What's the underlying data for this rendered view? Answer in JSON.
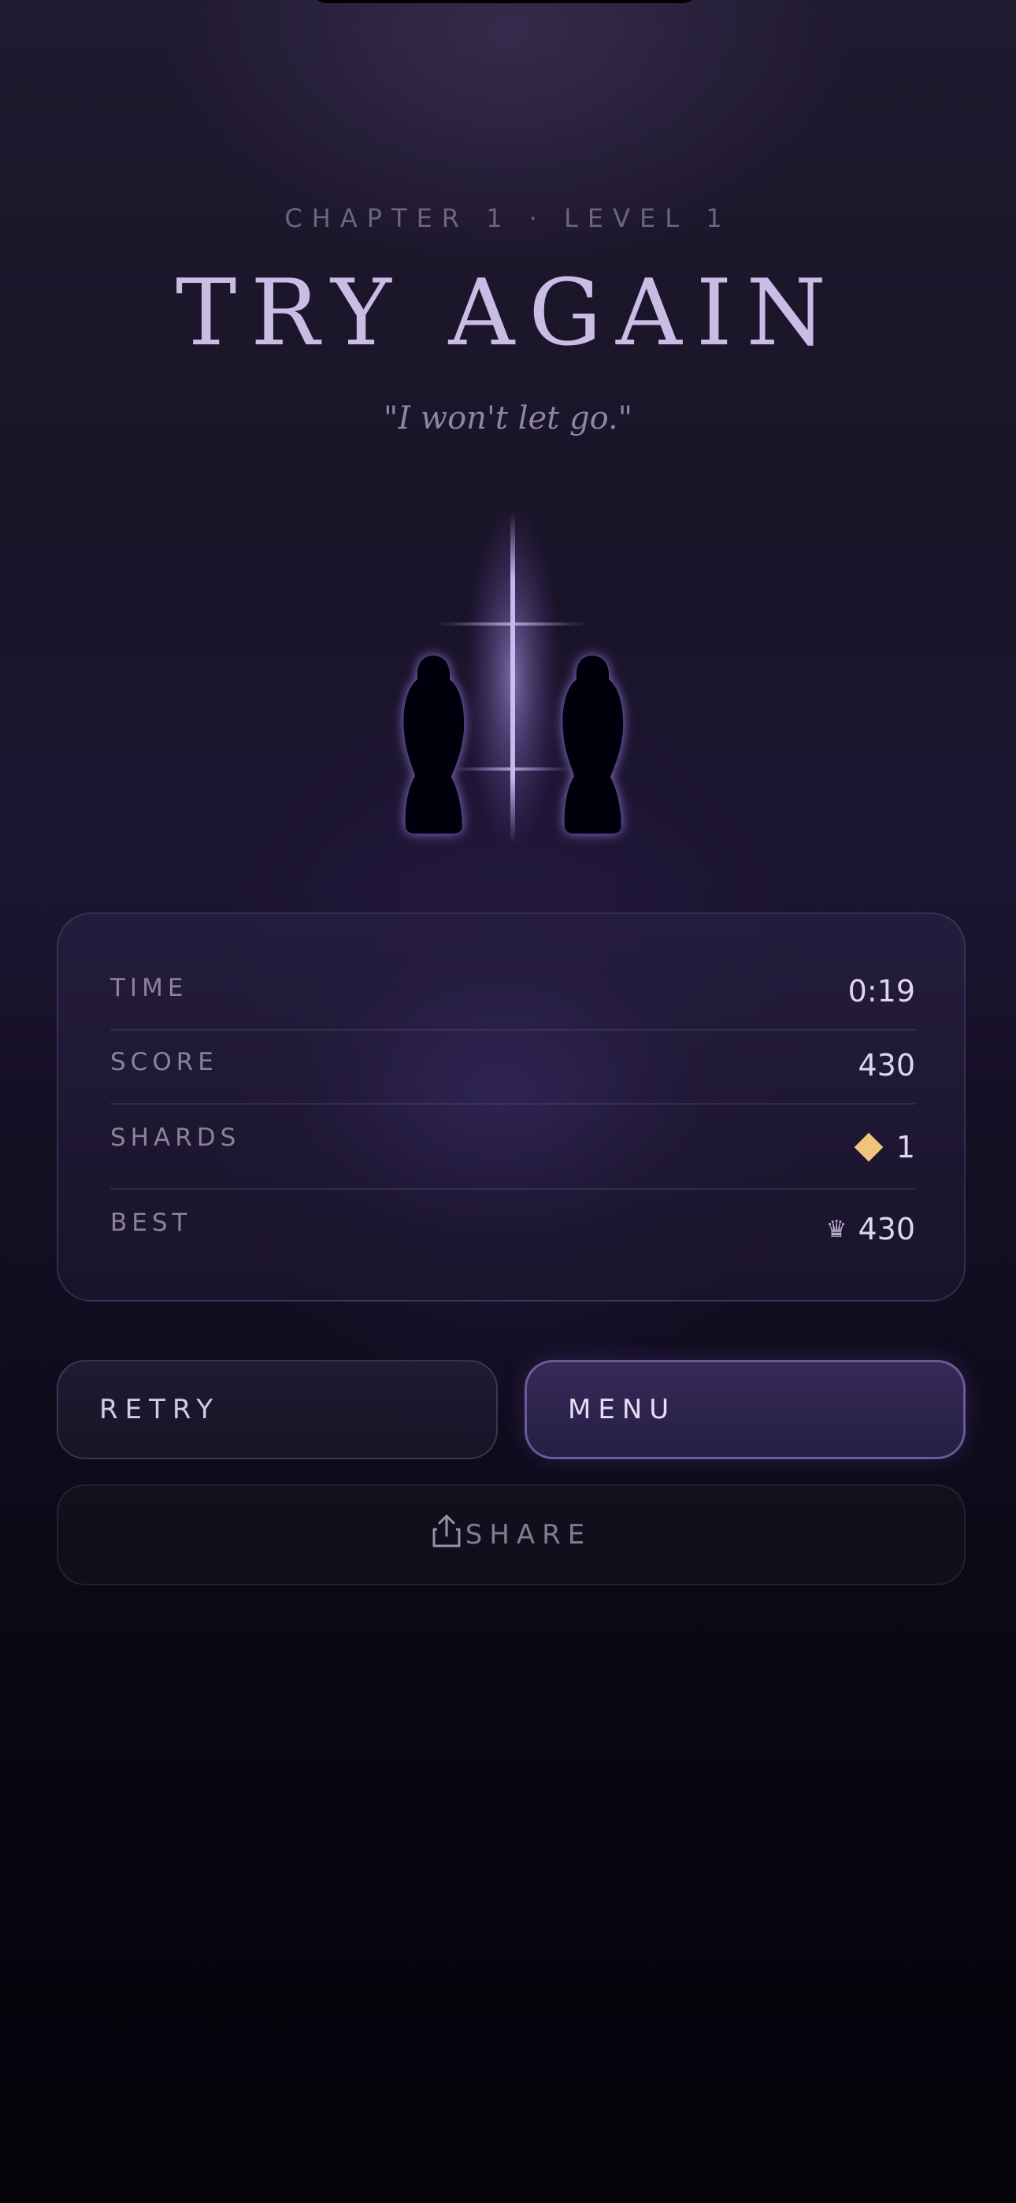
{
  "header": {
    "chapter_label": "CHAPTER 1 · LEVEL 1",
    "title": "TRY AGAIN",
    "quote": "\"I won't let go.\""
  },
  "illustration": {
    "name": "two-hooded-figures-with-light-pillar",
    "glow_color": "#a98ee8"
  },
  "stats": [
    {
      "label": "TIME",
      "value": "0:19"
    },
    {
      "label": "SCORE",
      "value": "430"
    },
    {
      "label": "SHARDS",
      "value": "1",
      "icon": "diamond-shard-icon"
    },
    {
      "label": "BEST",
      "value": "430",
      "icon": "crown-icon"
    }
  ],
  "buttons": {
    "retry": "RETRY",
    "menu": "MENU",
    "share": "SHARE"
  },
  "colors": {
    "accent": "#c9bde6",
    "shard": "#efc57a",
    "background_top": "#201a30",
    "background_bottom": "#04040a"
  }
}
